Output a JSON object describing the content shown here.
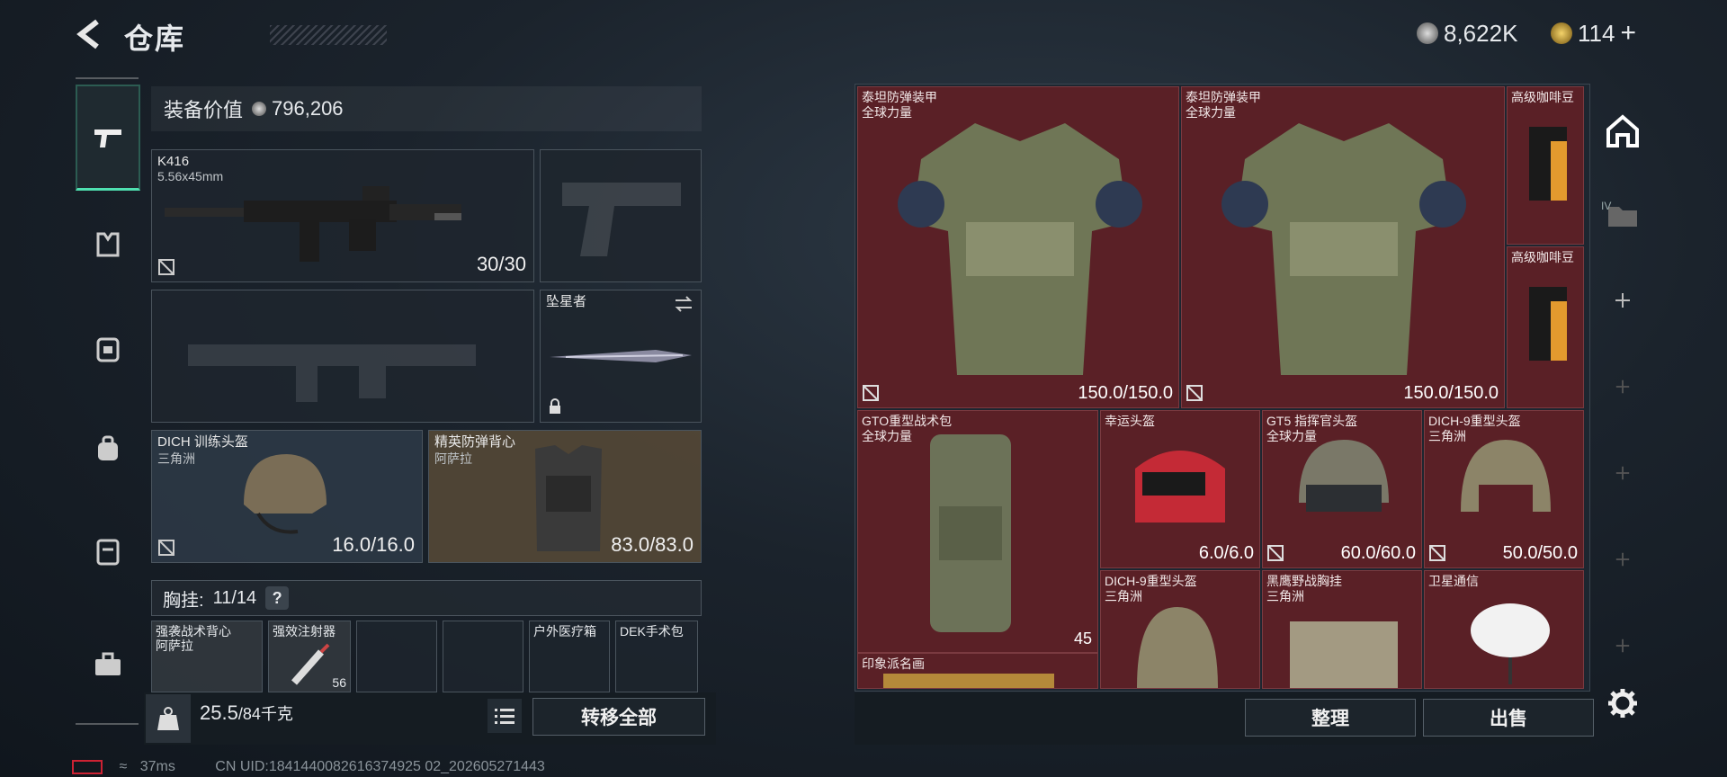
{
  "header": {
    "title": "仓库",
    "currency1": "8,622K",
    "currency2": "114",
    "plus": "+"
  },
  "equipment": {
    "value_label": "装备价值",
    "value": "796,206",
    "primary": {
      "name": "K416",
      "caliber": "5.56x45mm",
      "ammo": "30/30"
    },
    "melee": {
      "name": "坠星者"
    },
    "helmet": {
      "name": "DICH 训练头盔",
      "origin": "三角洲",
      "dur": "16.0/16.0"
    },
    "armor": {
      "name": "精英防弹背心",
      "origin": "阿萨拉",
      "dur": "83.0/83.0"
    },
    "rig": {
      "label": "胸挂:",
      "capacity": "11/14",
      "help": "?"
    },
    "rig_items": [
      {
        "name": "强袭战术背心",
        "origin": "阿萨拉"
      },
      {
        "name": "强效注射器",
        "count": "56"
      },
      {
        "name": ""
      },
      {
        "name": ""
      },
      {
        "name": "户外医疗箱"
      },
      {
        "name": "DEK手术包"
      }
    ],
    "weight": "25.5",
    "weight_max": "/84千克",
    "transfer_all": "转移全部"
  },
  "storage": {
    "items": [
      {
        "name": "泰坦防弹装甲",
        "origin": "全球力量",
        "dur": "150.0/150.0"
      },
      {
        "name": "泰坦防弹装甲",
        "origin": "全球力量",
        "dur": "150.0/150.0"
      },
      {
        "name": "高级咖啡豆"
      },
      {
        "name": "高级咖啡豆"
      },
      {
        "name": "GTO重型战术包",
        "origin": "全球力量",
        "count": "45"
      },
      {
        "name": "幸运头盔",
        "dur": "6.0/6.0"
      },
      {
        "name": "GT5 指挥官头盔",
        "origin": "全球力量",
        "dur": "60.0/60.0"
      },
      {
        "name": "DICH-9重型头盔",
        "origin": "三角洲",
        "dur": "50.0/50.0"
      },
      {
        "name": "DICH-9重型头盔",
        "origin": "三角洲"
      },
      {
        "name": "黑鹰野战胸挂",
        "origin": "三角洲"
      },
      {
        "name": "卫星通信"
      },
      {
        "name": "印象派名画"
      }
    ],
    "sort": "整理",
    "sell": "出售",
    "side_label": "IV"
  },
  "footer": {
    "ping": "37ms",
    "uid": "CN UID:1841440082616374925 02_202605271443"
  }
}
